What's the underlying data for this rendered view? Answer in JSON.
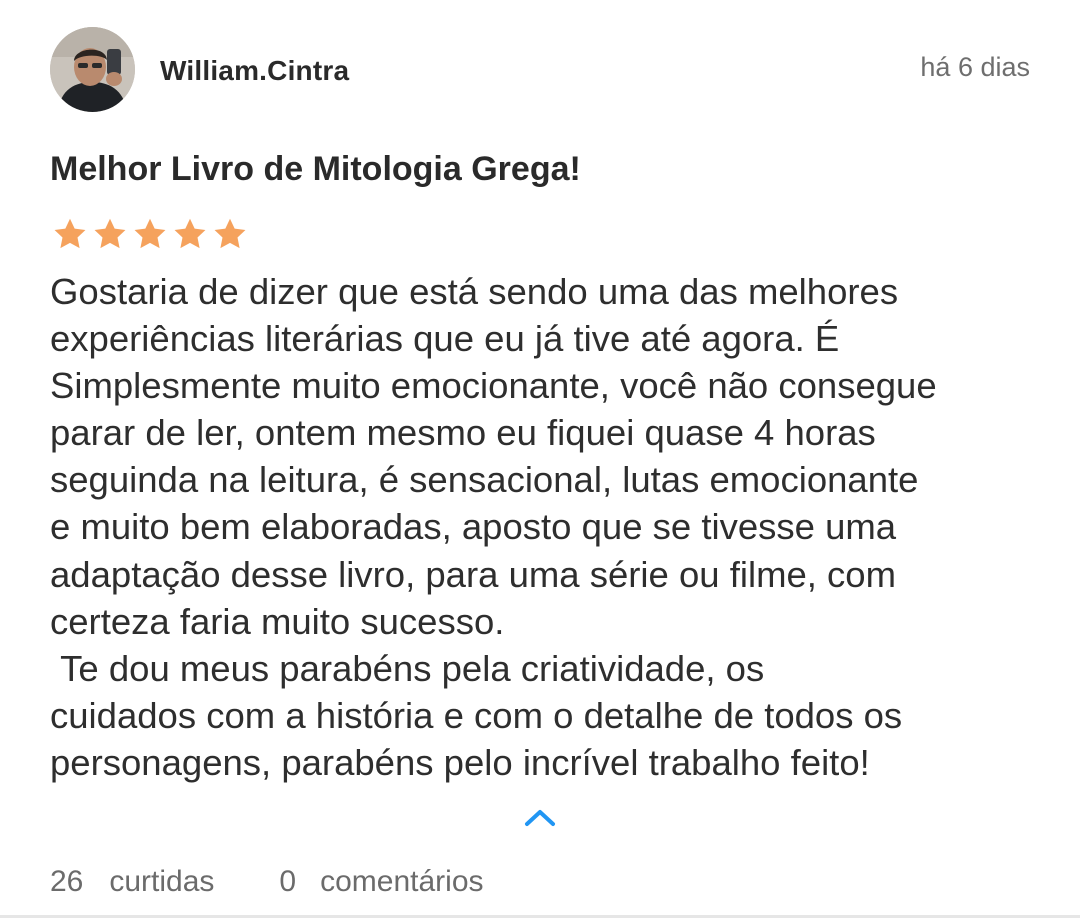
{
  "review": {
    "username": "William.Cintra",
    "time_ago": "há 6 dias",
    "title": "Melhor Livro de Mitologia Grega!",
    "rating": 5,
    "rating_max": 5,
    "star_color": "#F5A25D",
    "body_lines": [
      "Gostaria de dizer que está sendo uma das melhores",
      "experiências literárias que eu já tive até agora. É",
      "Simplesmente muito emocionante, você não consegue",
      "parar de ler, ontem mesmo eu fiquei quase 4 horas",
      "seguinda na leitura, é sensacional, lutas emocionante",
      "e muito bem elaboradas, aposto que se tivesse uma",
      "adaptação desse livro, para uma série ou filme, com",
      "certeza faria muito sucesso.",
      " Te dou meus parabéns pela criatividade, os",
      "cuidados com a história e com o detalhe de todos os",
      "personagens, parabéns pelo incrível trabalho feito!"
    ],
    "collapse_icon": "chevron-up-icon",
    "accent_color": "#2196F3"
  },
  "footer": {
    "likes_count": "26",
    "likes_label": "curtidas",
    "comments_count": "0",
    "comments_label": "comentários"
  }
}
